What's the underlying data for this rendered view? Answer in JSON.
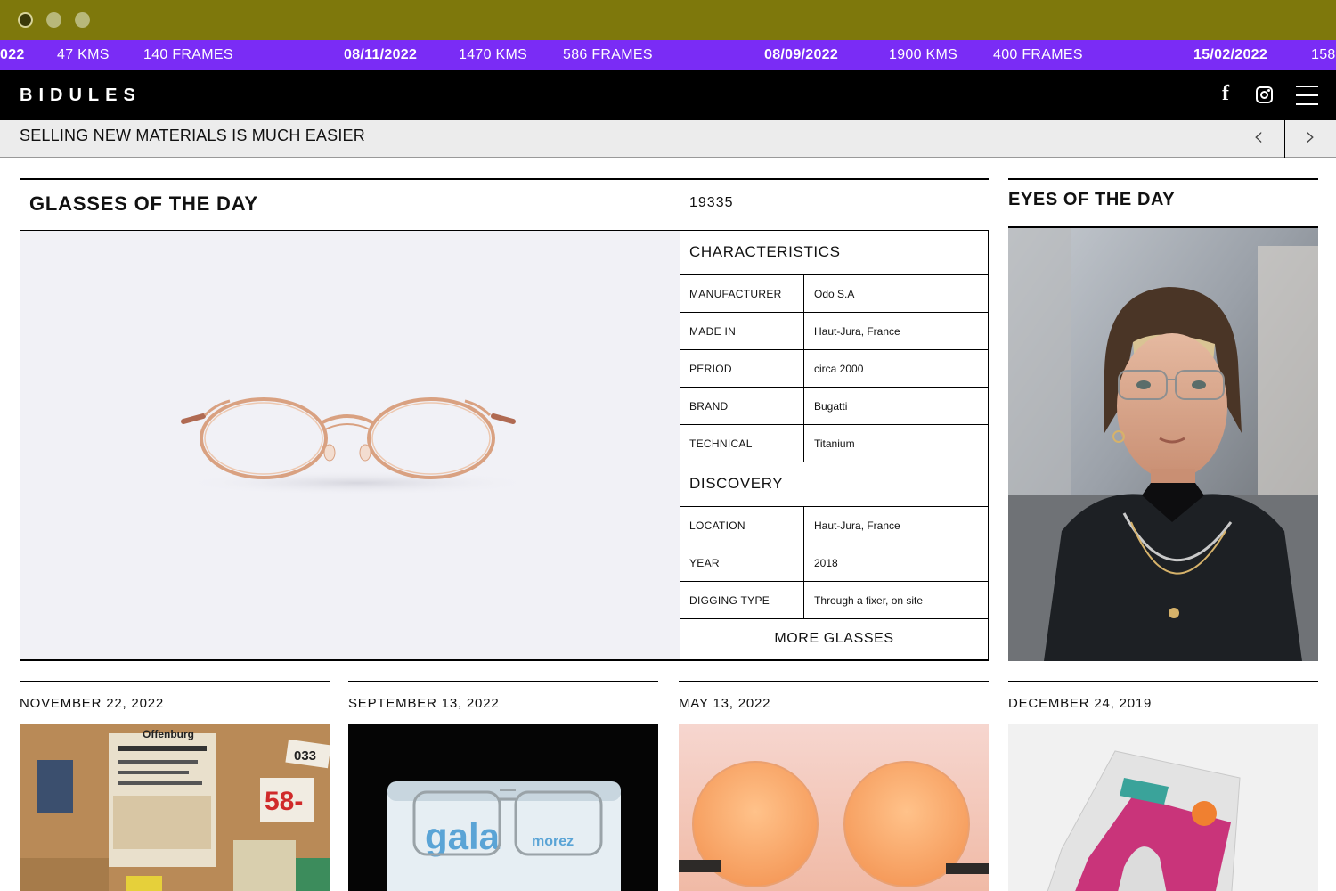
{
  "ticker": [
    {
      "text": "022",
      "kind": "date"
    },
    {
      "text": "47 KMS",
      "kind": "info"
    },
    {
      "text": "140 FRAMES",
      "kind": "info"
    },
    {
      "text": "08/11/2022",
      "kind": "date"
    },
    {
      "text": "1470 KMS",
      "kind": "info"
    },
    {
      "text": "586 FRAMES",
      "kind": "info"
    },
    {
      "text": "08/09/2022",
      "kind": "date"
    },
    {
      "text": "1900 KMS",
      "kind": "info"
    },
    {
      "text": "400 FRAMES",
      "kind": "info"
    },
    {
      "text": "15/02/2022",
      "kind": "date"
    },
    {
      "text": "158",
      "kind": "info"
    }
  ],
  "nav": {
    "logo": "BIDULES",
    "icons": [
      "facebook-icon",
      "instagram-icon",
      "hamburger-menu-icon"
    ]
  },
  "newsbar": {
    "message": "SELLING NEW MATERIALS IS MUCH EASIER",
    "prev_symbol": "‹",
    "next_symbol": "›"
  },
  "glasses_of_the_day": {
    "title": "GLASSES OF THE DAY",
    "number": "19335",
    "characteristics_title": "CHARACTERISTICS",
    "characteristics": [
      {
        "label": "MANUFACTURER",
        "value": "Odo S.A"
      },
      {
        "label": "MADE IN",
        "value": "Haut-Jura, France"
      },
      {
        "label": "PERIOD",
        "value": "circa 2000"
      },
      {
        "label": "BRAND",
        "value": "Bugatti"
      },
      {
        "label": "TECHNICAL",
        "value": "Titanium"
      }
    ],
    "discovery_title": "DISCOVERY",
    "discovery": [
      {
        "label": "LOCATION",
        "value": "Haut-Jura, France"
      },
      {
        "label": "YEAR",
        "value": "2018"
      },
      {
        "label": "DIGGING TYPE",
        "value": "Through a fixer, on site"
      }
    ],
    "more_label": "MORE GLASSES"
  },
  "eyes_of_the_day": {
    "title": "EYES OF THE DAY"
  },
  "cards": [
    {
      "date": "NOVEMBER 22, 2022"
    },
    {
      "date": "SEPTEMBER 13, 2022"
    },
    {
      "date": "MAY 13, 2022"
    },
    {
      "date": "DECEMBER 24, 2019"
    }
  ],
  "card_image_text": {
    "label_1": "Offenburg",
    "label_2": "58-",
    "label_3": "033",
    "brand_1": "gala",
    "brand_2": "morez"
  },
  "colors": {
    "chrome": "#7e780c",
    "ticker": "#7a2cf5",
    "nav": "#000000",
    "newsbar": "#ececec"
  }
}
